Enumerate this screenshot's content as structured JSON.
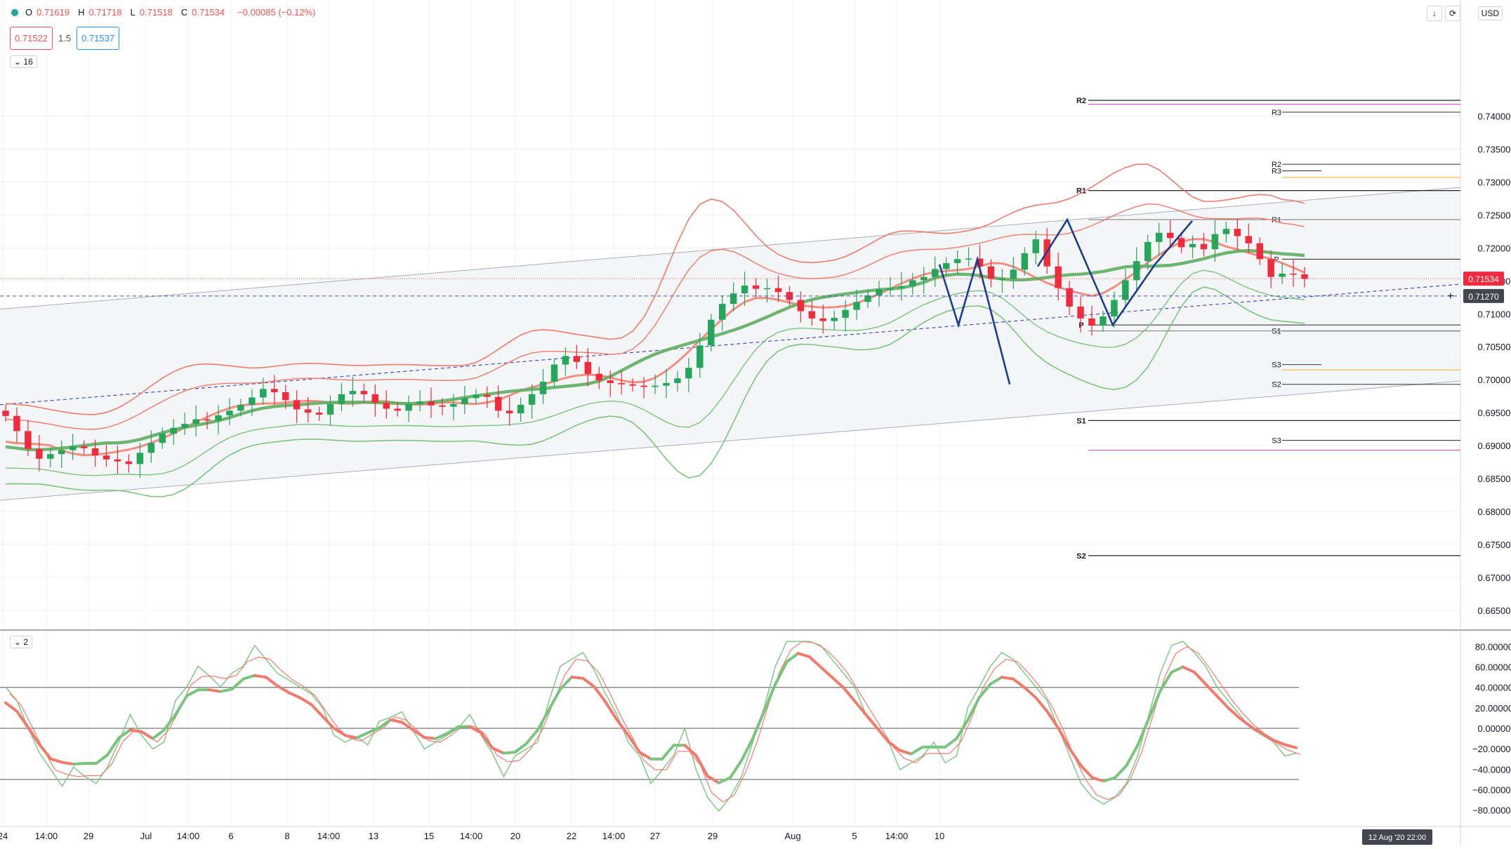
{
  "header": {
    "ohlc": [
      {
        "label": "O",
        "value": "0.71619"
      },
      {
        "label": "H",
        "value": "0.71718"
      },
      {
        "label": "L",
        "value": "0.71518"
      },
      {
        "label": "C",
        "value": "0.71534"
      },
      {
        "label": "",
        "value": "−0.00085 (−0.12%)"
      }
    ],
    "sell_price": "0.71522",
    "spread": "1.5",
    "buy_price": "0.71537",
    "interval_toggle": "16",
    "oscillator_toggle": "2",
    "currency": "USD"
  },
  "colors": {
    "up": "#26a65b",
    "down": "#ef2b3d",
    "band_red": "#f07b6d",
    "band_green": "#7bc47f",
    "pivot_blue": "#1c3d8f",
    "grid": "#eef0f3",
    "axis_text": "#131722"
  },
  "chart_data": {
    "type": "line",
    "symbol_note": "",
    "price_axis": {
      "ticks": [
        "0.74000",
        "0.73500",
        "0.73000",
        "0.72500",
        "0.72000",
        "0.71500",
        "0.71000",
        "0.70500",
        "0.70000",
        "0.69500",
        "0.69000",
        "0.68500",
        "0.68000",
        "0.67500",
        "0.67000",
        "0.66500"
      ],
      "tick_values": [
        0.74,
        0.735,
        0.73,
        0.725,
        0.72,
        0.715,
        0.71,
        0.705,
        0.7,
        0.695,
        0.69,
        0.685,
        0.68,
        0.675,
        0.67,
        0.665
      ],
      "ylim": [
        0.662,
        0.7555
      ],
      "last_price_label": "0.71534",
      "last_price": 0.71534,
      "crosshair_label": "0.71270",
      "crosshair_price": 0.7127
    },
    "time_axis": {
      "labels": [
        "24",
        "14:00",
        "29",
        "Jul",
        "14:00",
        "6",
        "8",
        "14:00",
        "13",
        "15",
        "14:00",
        "20",
        "22",
        "14:00",
        "27",
        "29",
        "Aug",
        "5",
        "14:00",
        "10"
      ],
      "label_x": [
        4,
        66,
        126,
        208,
        268,
        329,
        409,
        468,
        532,
        611,
        671,
        734,
        814,
        874,
        933,
        1015,
        1129,
        1217,
        1277,
        1338
      ],
      "crosshair_time": "12 Aug '20   22:00"
    },
    "oscillator_axis": {
      "ticks": [
        "80.00000",
        "60.00000",
        "40.00000",
        "20.00000",
        "0.00000",
        "−20.00000",
        "−40.00000",
        "−60.00000",
        "−80.00000"
      ],
      "tick_values": [
        80,
        60,
        40,
        20,
        0,
        -20,
        -40,
        -60,
        -80
      ],
      "levels": [
        40,
        0,
        -50
      ],
      "ylim": [
        -92,
        92
      ]
    },
    "candles": {
      "note": "simplified reconstruction of the hourly AUDUSD-style candle path; x positions are index-based",
      "closes": [
        0.6945,
        0.6922,
        0.6895,
        0.688,
        0.6887,
        0.6893,
        0.6899,
        0.6896,
        0.6885,
        0.6879,
        0.6876,
        0.6872,
        0.6889,
        0.6904,
        0.6918,
        0.6927,
        0.6933,
        0.694,
        0.6938,
        0.6946,
        0.6953,
        0.6962,
        0.6973,
        0.6986,
        0.6981,
        0.6969,
        0.6955,
        0.695,
        0.6947,
        0.6963,
        0.6978,
        0.6983,
        0.6978,
        0.6965,
        0.6956,
        0.6953,
        0.6963,
        0.6967,
        0.6961,
        0.6959,
        0.6963,
        0.6972,
        0.6977,
        0.6974,
        0.6953,
        0.6949,
        0.6962,
        0.6978,
        0.6997,
        0.7023,
        0.7036,
        0.7027,
        0.7009,
        0.6999,
        0.6995,
        0.6993,
        0.6991,
        0.6989,
        0.6991,
        0.6995,
        0.7002,
        0.7018,
        0.7052,
        0.7091,
        0.7115,
        0.7131,
        0.7143,
        0.7138,
        0.7139,
        0.7133,
        0.7121,
        0.7104,
        0.7093,
        0.7089,
        0.7094,
        0.7106,
        0.7118,
        0.7128,
        0.7137,
        0.7139,
        0.7142,
        0.7151,
        0.7156,
        0.7168,
        0.7177,
        0.7183,
        0.7184,
        0.7172,
        0.7153,
        0.7153,
        0.7167,
        0.7192,
        0.7213,
        0.7172,
        0.7139,
        0.7111,
        0.7093,
        0.7082,
        0.7096,
        0.7121,
        0.7151,
        0.718,
        0.7209,
        0.7223,
        0.7215,
        0.7201,
        0.7206,
        0.7198,
        0.7221,
        0.7229,
        0.7218,
        0.7207,
        0.7183,
        0.7156,
        0.7161,
        0.716,
        0.7153
      ]
    },
    "series": [
      {
        "name": "",
        "color": "#7bc47f",
        "role": "channel"
      },
      {
        "name": "",
        "color": "#f07b6d",
        "role": "channel"
      }
    ],
    "pivot_labels": {
      "weekly": [
        {
          "label": "R2",
          "value": 0.7424
        },
        {
          "label": "R1",
          "value": 0.7287
        },
        {
          "label": "P",
          "value": 0.7083
        },
        {
          "label": "S1",
          "value": 0.6938
        },
        {
          "label": "S2",
          "value": 0.6733
        }
      ],
      "daily": [
        {
          "label": "R3",
          "value": 0.7406
        },
        {
          "label": "R2",
          "value": 0.7327
        },
        {
          "label": "R3",
          "value": 0.7317
        },
        {
          "label": "R1",
          "value": 0.7243
        },
        {
          "label": "P",
          "value": 0.7183
        },
        {
          "label": "S1",
          "value": 0.7074
        },
        {
          "label": "S3",
          "value": 0.7023
        },
        {
          "label": "S2",
          "value": 0.6993
        },
        {
          "label": "S3",
          "value": 0.6908
        }
      ]
    },
    "projection": {
      "color": "#1c3d8f",
      "points": [
        [
          1338,
          0.7175
        ],
        [
          1365,
          0.7083
        ],
        [
          1392,
          0.7183
        ],
        [
          1438,
          0.6993
        ]
      ]
    },
    "oscillator": {
      "note": "stochastic-style oscillator with %K/%D lines; values approximated",
      "k": [
        30,
        20,
        0,
        -18,
        -30,
        -42,
        -28,
        -35,
        -40,
        -28,
        -10,
        10,
        -5,
        -15,
        -10,
        20,
        30,
        45,
        38,
        30,
        40,
        45,
        60,
        50,
        40,
        35,
        30,
        25,
        15,
        -5,
        -10,
        -6,
        -12,
        5,
        8,
        12,
        -2,
        -15,
        -10,
        -5,
        0,
        10,
        -5,
        -18,
        -35,
        -20,
        -15,
        -10,
        20,
        45,
        50,
        55,
        42,
        25,
        10,
        -10,
        -20,
        -40,
        -30,
        -20,
        0,
        -30,
        -50,
        -60,
        -50,
        -35,
        -10,
        15,
        45,
        70,
        80,
        70,
        60,
        50,
        40,
        30,
        10,
        0,
        -10,
        -30,
        -25,
        -20,
        -10,
        -25,
        -20,
        15,
        30,
        45,
        55,
        50,
        40,
        30,
        20,
        0,
        -20,
        -40,
        -50,
        -55,
        -50,
        -40,
        -20,
        10,
        40,
        60,
        65,
        55,
        45,
        30,
        20,
        10,
        0,
        -5,
        -10,
        -20,
        -18
      ]
    }
  }
}
